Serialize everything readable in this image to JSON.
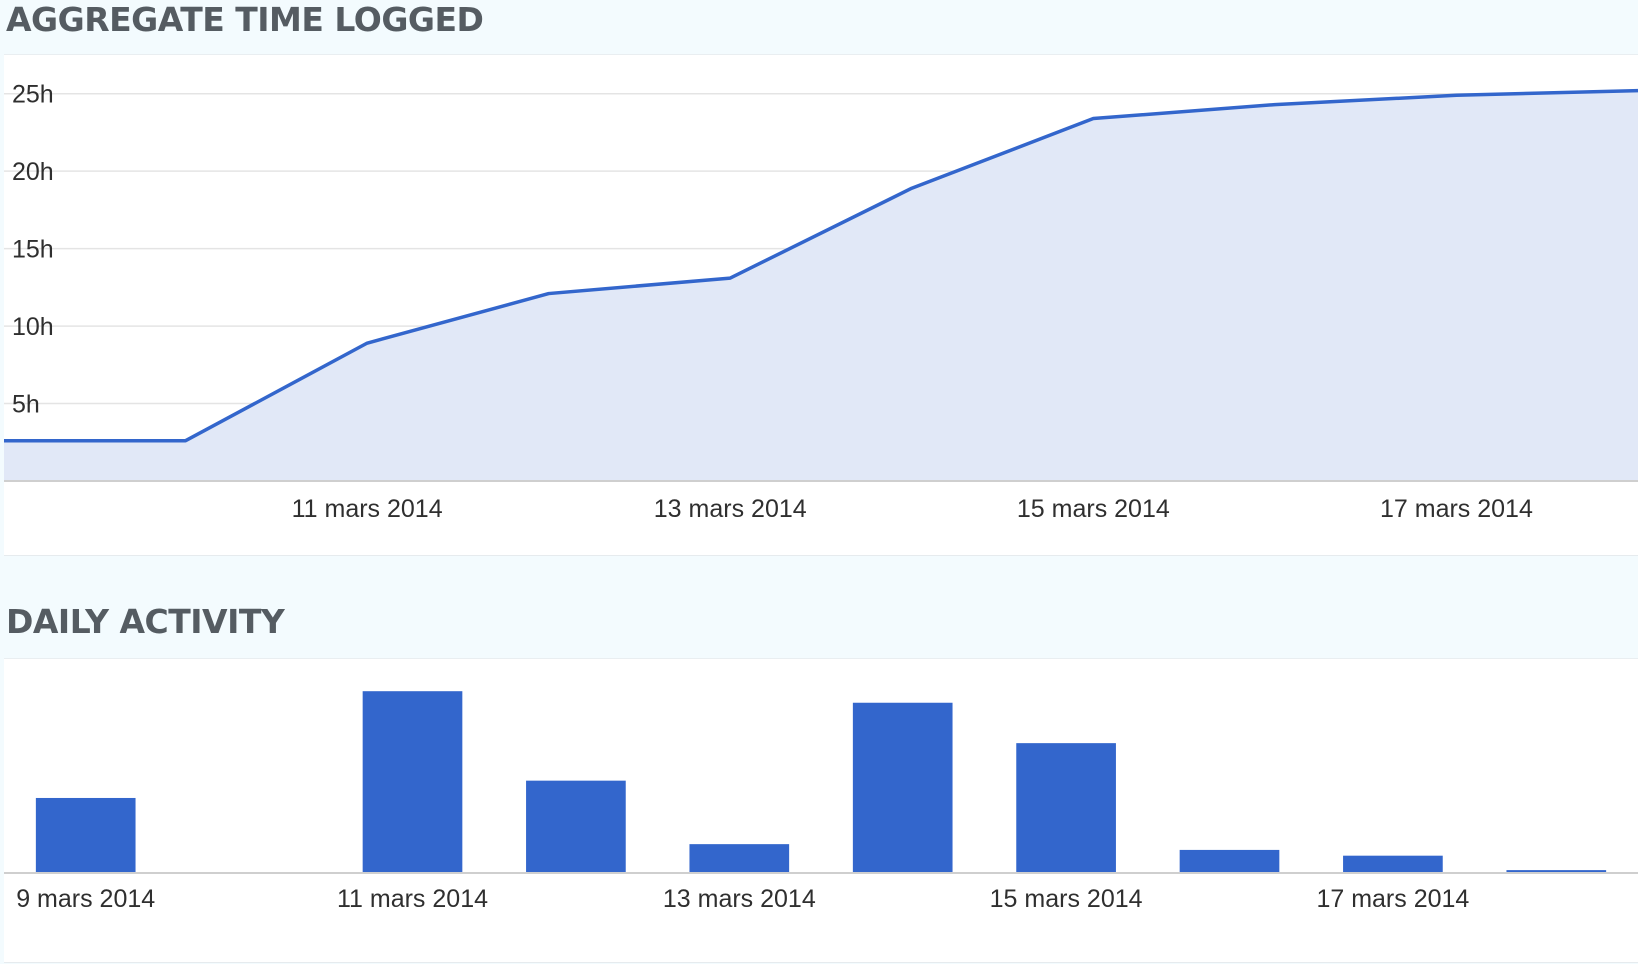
{
  "aggregate": {
    "title": "AGGREGATE TIME LOGGED"
  },
  "daily": {
    "title": "DAILY ACTIVITY"
  },
  "colors": {
    "line": "#3366cc",
    "area_fill": "#e1e8f7",
    "bar": "#3366cc",
    "grid": "#e4e4e4",
    "axis": "#cfcfcf",
    "text": "#2f2f2f",
    "title": "#555c62",
    "background": "#f3fbfe"
  },
  "chart_data": [
    {
      "type": "area",
      "title": "AGGREGATE TIME LOGGED",
      "xlabel": "",
      "ylabel": "",
      "y_unit": "h",
      "x": [
        "2014-03-09",
        "2014-03-10",
        "2014-03-11",
        "2014-03-12",
        "2014-03-13",
        "2014-03-14",
        "2014-03-15",
        "2014-03-16",
        "2014-03-17",
        "2014-03-18"
      ],
      "values": [
        2.6,
        2.6,
        8.9,
        12.1,
        13.1,
        18.9,
        23.4,
        24.3,
        24.9,
        25.2
      ],
      "ylim": [
        0,
        27.5
      ],
      "yticks": [
        5,
        10,
        15,
        20,
        25
      ],
      "ytick_labels": [
        "5h",
        "10h",
        "15h",
        "20h",
        "25h"
      ],
      "xticks": [
        "2014-03-11",
        "2014-03-13",
        "2014-03-15",
        "2014-03-17"
      ],
      "xtick_labels": [
        "11 mars 2014",
        "13 mars 2014",
        "15 mars 2014",
        "17 mars 2014"
      ],
      "grid": true,
      "legend": "none"
    },
    {
      "type": "bar",
      "title": "DAILY ACTIVITY",
      "xlabel": "",
      "ylabel": "",
      "y_unit": "h",
      "categories": [
        "2014-03-09",
        "2014-03-10",
        "2014-03-11",
        "2014-03-12",
        "2014-03-13",
        "2014-03-14",
        "2014-03-15",
        "2014-03-16",
        "2014-03-17",
        "2014-03-18"
      ],
      "values": [
        2.6,
        0,
        6.3,
        3.2,
        1.0,
        5.9,
        4.5,
        0.8,
        0.6,
        0.1
      ],
      "ylim": [
        0,
        7.0
      ],
      "xticks": [
        "2014-03-09",
        "2014-03-11",
        "2014-03-13",
        "2014-03-15",
        "2014-03-17"
      ],
      "xtick_labels": [
        "9 mars 2014",
        "11 mars 2014",
        "13 mars 2014",
        "15 mars 2014",
        "17 mars 2014"
      ],
      "grid": false,
      "legend": "none"
    }
  ]
}
